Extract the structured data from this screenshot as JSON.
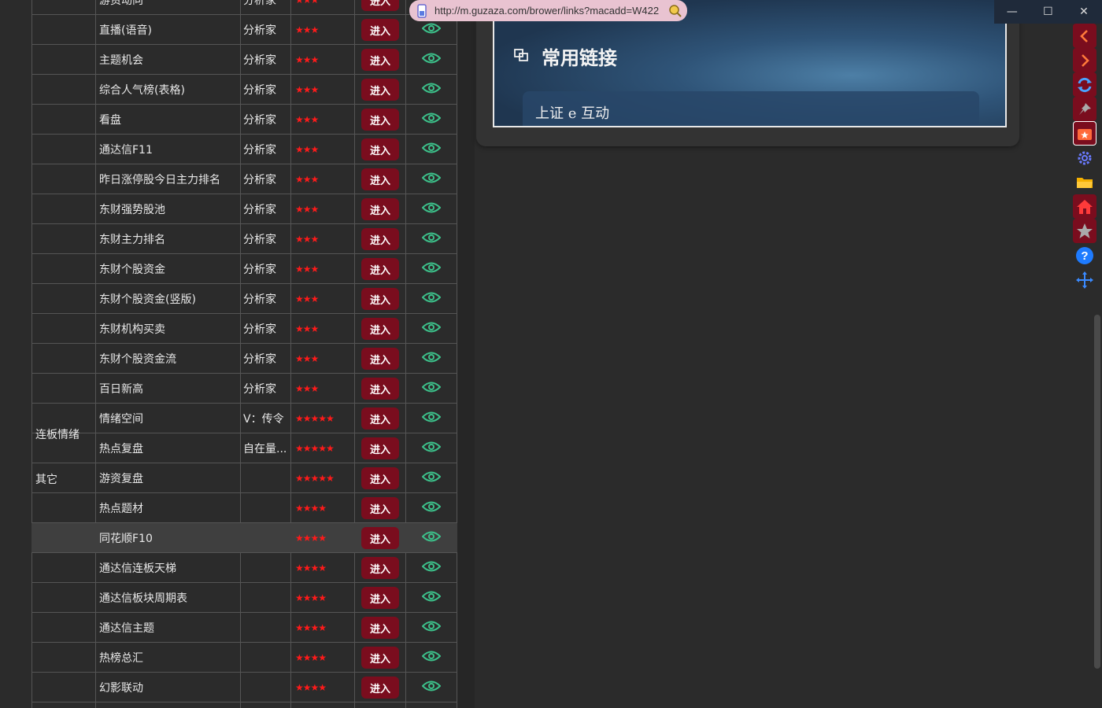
{
  "url_bar": {
    "url": "http://m.guzaza.com/brower/links?macadd=W422"
  },
  "banner": {
    "title": "常用链接",
    "link_label": "上证 e 互动"
  },
  "table": {
    "enter_label": "进入",
    "groups": [
      {
        "label": "连板情绪"
      },
      {
        "label": "其它"
      }
    ],
    "rows": [
      {
        "name": "游资动向",
        "type": "分析家",
        "stars": "★★★"
      },
      {
        "name": "直播(语音)",
        "type": "分析家",
        "stars": "★★★"
      },
      {
        "name": "主题机会",
        "type": "分析家",
        "stars": "★★★"
      },
      {
        "name": "综合人气榜(表格)",
        "type": "分析家",
        "stars": "★★★"
      },
      {
        "name": "看盘",
        "type": "分析家",
        "stars": "★★★"
      },
      {
        "name": "通达信F11",
        "type": "分析家",
        "stars": "★★★"
      },
      {
        "name": "昨日涨停股今日主力排名",
        "type": "分析家",
        "stars": "★★★"
      },
      {
        "name": "东财强势股池",
        "type": "分析家",
        "stars": "★★★"
      },
      {
        "name": "东财主力排名",
        "type": "分析家",
        "stars": "★★★"
      },
      {
        "name": "东财个股资金",
        "type": "分析家",
        "stars": "★★★"
      },
      {
        "name": "东财个股资金(竖版)",
        "type": "分析家",
        "stars": "★★★"
      },
      {
        "name": "东财机构买卖",
        "type": "分析家",
        "stars": "★★★"
      },
      {
        "name": "东财个股资金流",
        "type": "分析家",
        "stars": "★★★"
      },
      {
        "name": "百日新高",
        "type": "分析家",
        "stars": "★★★"
      },
      {
        "name": "情绪空间",
        "type": "V：传令",
        "stars": "★★★★★"
      },
      {
        "name": "热点复盘",
        "type": "自在量...",
        "stars": "★★★★★"
      },
      {
        "name": "游资复盘",
        "type": "",
        "stars": "★★★★★"
      },
      {
        "name": "热点题材",
        "type": "",
        "stars": "★★★★"
      },
      {
        "name": "同花顺F10",
        "type": "",
        "stars": "★★★★"
      },
      {
        "name": "通达信连板天梯",
        "type": "",
        "stars": "★★★★"
      },
      {
        "name": "通达信板块周期表",
        "type": "",
        "stars": "★★★★"
      },
      {
        "name": "通达信主题",
        "type": "",
        "stars": "★★★★"
      },
      {
        "name": "热榜总汇",
        "type": "",
        "stars": "★★★★"
      },
      {
        "name": "幻影联动",
        "type": "",
        "stars": "★★★★"
      }
    ]
  },
  "window_controls": {
    "minimize": "—",
    "maximize": "☐",
    "close": "✕"
  },
  "sidebar": [
    {
      "icon": "chevron-left-icon"
    },
    {
      "icon": "chevron-right-icon"
    },
    {
      "icon": "refresh-icon"
    },
    {
      "icon": "pin-icon"
    },
    {
      "icon": "bookmark-folder-icon"
    },
    {
      "icon": "settings-icon"
    },
    {
      "icon": "folder-icon"
    },
    {
      "icon": "home-icon"
    },
    {
      "icon": "star-icon"
    },
    {
      "icon": "help-icon"
    },
    {
      "icon": "move-icon"
    }
  ],
  "colors": {
    "accent": "#7a0d1e",
    "star": "#ff1a1a",
    "eye": "#3cc08a",
    "bg": "#2b2b2b"
  }
}
